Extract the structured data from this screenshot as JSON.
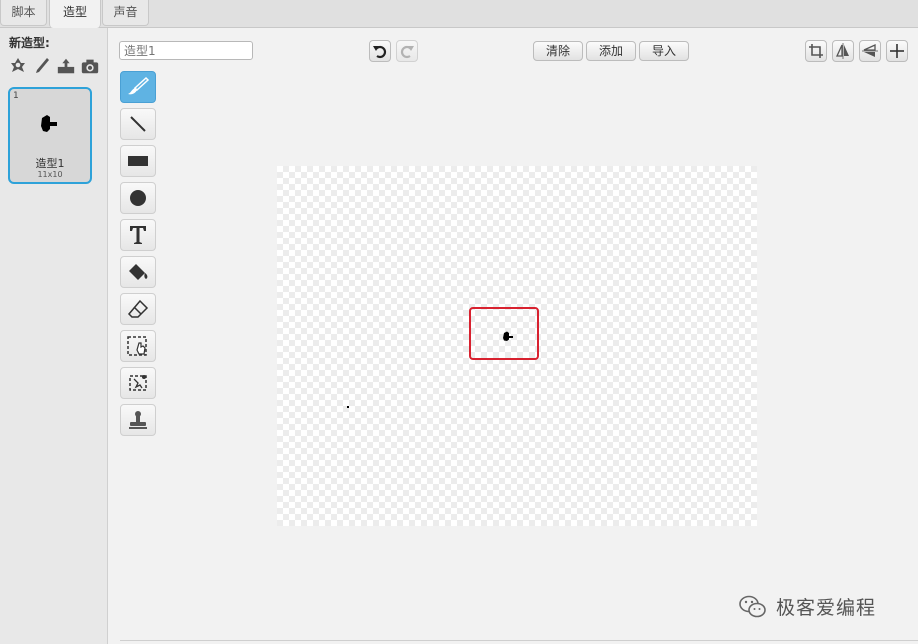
{
  "tabs": [
    {
      "label": "脚本",
      "active": false
    },
    {
      "label": "造型",
      "active": true
    },
    {
      "label": "声音",
      "active": false
    }
  ],
  "sidebar": {
    "new_costume_label": "新造型:",
    "new_icons": [
      "choose-from-library-icon",
      "paint-brush-icon",
      "upload-icon",
      "camera-icon"
    ],
    "costumes": [
      {
        "number": "1",
        "name": "造型1",
        "size": "11x10",
        "selected": true
      }
    ]
  },
  "editor": {
    "costume_name_placeholder": "造型1",
    "history_buttons": [
      "undo-icon",
      "redo-icon"
    ],
    "action_buttons": {
      "clear": "清除",
      "add": "添加",
      "import": "导入"
    },
    "transform_buttons": [
      "crop-icon",
      "flip-horizontal-icon",
      "flip-vertical-icon",
      "set-center-icon"
    ],
    "tools": [
      "brush-icon",
      "line-icon",
      "rectangle-icon",
      "ellipse-icon",
      "text-icon",
      "fill-icon",
      "eraser-icon",
      "select-icon",
      "select-clone-icon",
      "stamp-icon"
    ],
    "active_tool": "brush-icon"
  },
  "colors": {
    "accent": "#2ea2d9",
    "active_tool": "#5fb3e3",
    "highlight": "#d8212f"
  },
  "watermark": {
    "text": "极客爱编程"
  }
}
